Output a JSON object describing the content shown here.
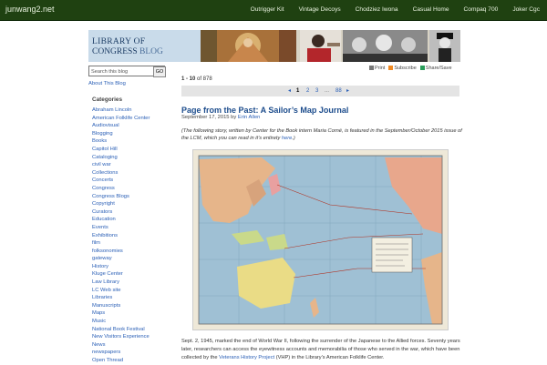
{
  "header": {
    "site_title": "junwang2.net",
    "nav": [
      "Outrigger Kit",
      "Vintage Decoys",
      "Chodziez Iwona",
      "Casual Home",
      "Compaq 700",
      "Joker Cgc"
    ]
  },
  "banner": {
    "logo_line1": "LIBRARY OF",
    "logo_line2": "CONGRESS",
    "logo_blog": "BLOG"
  },
  "sidebar": {
    "search_placeholder": "Search this blog",
    "search_button": "GO",
    "about_link": "About This Blog",
    "categories_heading": "Categories",
    "categories": [
      "Abraham Lincoln",
      "American Folklife Center",
      "Audiovisual",
      "Blogging",
      "Books",
      "Capitol Hill",
      "Cataloging",
      "civil war",
      "Collections",
      "Concerts",
      "Congress",
      "Congress Blogs",
      "Copyright",
      "Curators",
      "Education",
      "Events",
      "Exhibitions",
      "film",
      "folksonomies",
      "gateway",
      "History",
      "Kluge Center",
      "Law Library",
      "LC Web site",
      "Libraries",
      "Manuscripts",
      "Maps",
      "Music",
      "National Book Festival",
      "New Visitors Experience",
      "News",
      "newspapers",
      "Open Thread"
    ]
  },
  "content": {
    "results_prefix": "1 - 10",
    "results_suffix": "of 878",
    "tools": [
      "Print",
      "Subscribe",
      "Share/Save"
    ],
    "pager": {
      "prev": "◂",
      "current": "1",
      "pages": [
        "2",
        "3"
      ],
      "ellipsis": "...",
      "last": "88",
      "next": "▸"
    },
    "post_title": "Page from the Past: A Sailor’s Map Journal",
    "post_date": "September 17, 2015",
    "post_by": "by",
    "post_author": "Erin Allen",
    "intro_text": "(The following story, written by Center for the Book intern Maria Corné, is featured in the September/October 2015 issue of the LCM, which you can read in it’s entirety ",
    "intro_link": "here",
    "intro_end": ".)",
    "map_caption": "COMPARATIVE DISTANCES IN THE PACIFIC OCEAN",
    "body_part1": "Sept. 2, 1945, marked the end of World War II, following the surrender of the Japanese to the Allied forces. Seventy years later, researchers can access the eyewitness accounts and memorabilia of those who served in the war, which have been collected by the ",
    "body_link": "Veterans History Project",
    "body_part2": " (VHP) in the Library’s American Folklife Center."
  },
  "colors": {
    "topbar": "#1f4111",
    "link": "#2a5fb6",
    "title": "#1c4c8c"
  }
}
